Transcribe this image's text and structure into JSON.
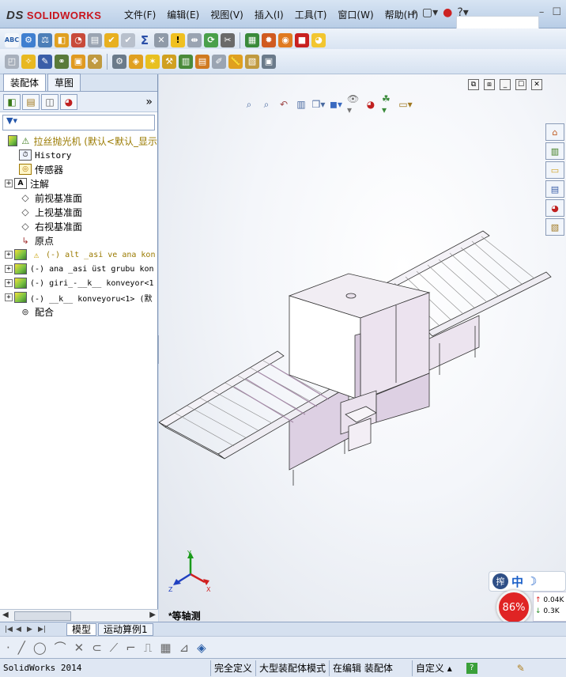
{
  "app": {
    "brand": "SOLIDWORKS",
    "brand_prefix": "DS"
  },
  "menu": [
    "文件(F)",
    "编辑(E)",
    "视图(V)",
    "插入(I)",
    "工具(T)",
    "窗口(W)",
    "帮助(H)"
  ],
  "panel": {
    "tabs": [
      "装配体",
      "草图"
    ],
    "filter_icon": "filter-icon",
    "more": "»"
  },
  "tree": {
    "root": "拉丝抛光机  (默认<默认_显示",
    "items": [
      {
        "label": "History",
        "icon": "history-icon",
        "expand": false
      },
      {
        "label": "传感器",
        "icon": "sensor-icon",
        "expand": false
      },
      {
        "label": "注解",
        "icon": "annotation-icon",
        "expand": true
      },
      {
        "label": "前视基准面",
        "icon": "plane-icon",
        "expand": false
      },
      {
        "label": "上视基准面",
        "icon": "plane-icon",
        "expand": false
      },
      {
        "label": "右视基准面",
        "icon": "plane-icon",
        "expand": false
      },
      {
        "label": "原点",
        "icon": "origin-icon",
        "expand": false
      },
      {
        "label": "(-) alt _asi ve ana kon",
        "icon": "assembly-warning-icon",
        "expand": true
      },
      {
        "label": "(-) ana _asi üst grubu kon",
        "icon": "assembly-icon",
        "expand": true
      },
      {
        "label": "(-) giri_-__k__ konveyor<1",
        "icon": "assembly-icon",
        "expand": true
      },
      {
        "label": "(-) __k__ konveyoru<1> (默",
        "icon": "assembly-icon",
        "expand": true
      },
      {
        "label": "配合",
        "icon": "mate-icon",
        "expand": false
      }
    ]
  },
  "viewport": {
    "view_name": "*等轴测",
    "triad": {
      "x": "X",
      "y": "Y",
      "z": "Z"
    }
  },
  "bottom_tabs": [
    "模型",
    "运动算例1"
  ],
  "ime": {
    "label": "中",
    "badge": "搾"
  },
  "network": {
    "percent": "86%",
    "up": "0.04K",
    "down": "0.3K"
  },
  "status": {
    "app": "SolidWorks 2014",
    "cells": [
      "完全定义",
      "大型装配体模式",
      "在编辑 装配体"
    ],
    "custom": "自定义",
    "help": "?"
  }
}
